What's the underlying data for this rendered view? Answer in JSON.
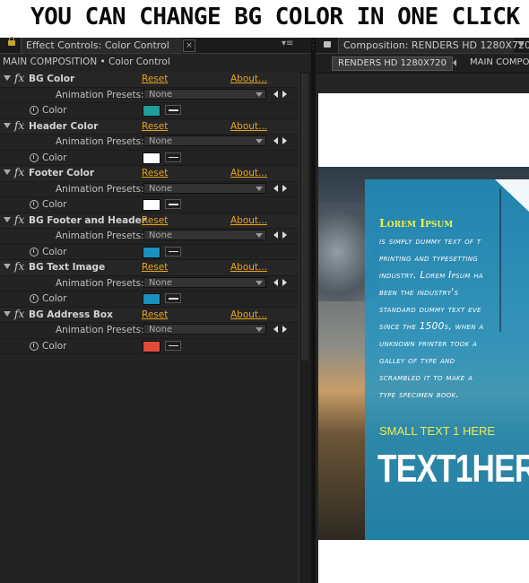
{
  "banner": {
    "text": "YOU CAN CHANGE BG COLOR IN ONE CLICK"
  },
  "effect_controls": {
    "tab_label": "Effect Controls: Color Control",
    "tab_close": "×",
    "menu_glyph": "▾≡",
    "breadcrumb": "MAIN COMPOSITION • Color Control",
    "fx_glyph": "fx",
    "reset_label": "Reset",
    "about_label": "About...",
    "presets_label": "Animation Presets:",
    "preset_value": "None",
    "color_label": "Color",
    "effects": [
      {
        "name": "BG Color",
        "color": "#1f9e9b"
      },
      {
        "name": "Header Color",
        "color": "#ffffff"
      },
      {
        "name": "Footer Color",
        "color": "#ffffff"
      },
      {
        "name": "BG Footer and Header",
        "color": "#1a8fc0"
      },
      {
        "name": "BG Text Image",
        "color": "#1a8fc0"
      },
      {
        "name": "BG Address Box",
        "color": "#e24b3b"
      }
    ]
  },
  "composition": {
    "tab_label": "Composition: RENDERS HD 1280X720",
    "crumb_active": "RENDERS HD 1280X720",
    "crumb_next": "MAIN COMPO",
    "preview": {
      "title": "Lorem Ipsum",
      "body_lines": [
        "is simply dummy text of t",
        "printing and typesetting",
        "industry. Lorem Ipsum ha",
        "been the industry's",
        "standard dummy text eve",
        "since the 1500s, when a",
        "unknown printer took a",
        "galley of type and",
        "scrambled it to make a",
        "type specimen book."
      ],
      "small_text": "SMALL TEXT 1 HERE",
      "big_text": "TEXT1HER"
    }
  }
}
